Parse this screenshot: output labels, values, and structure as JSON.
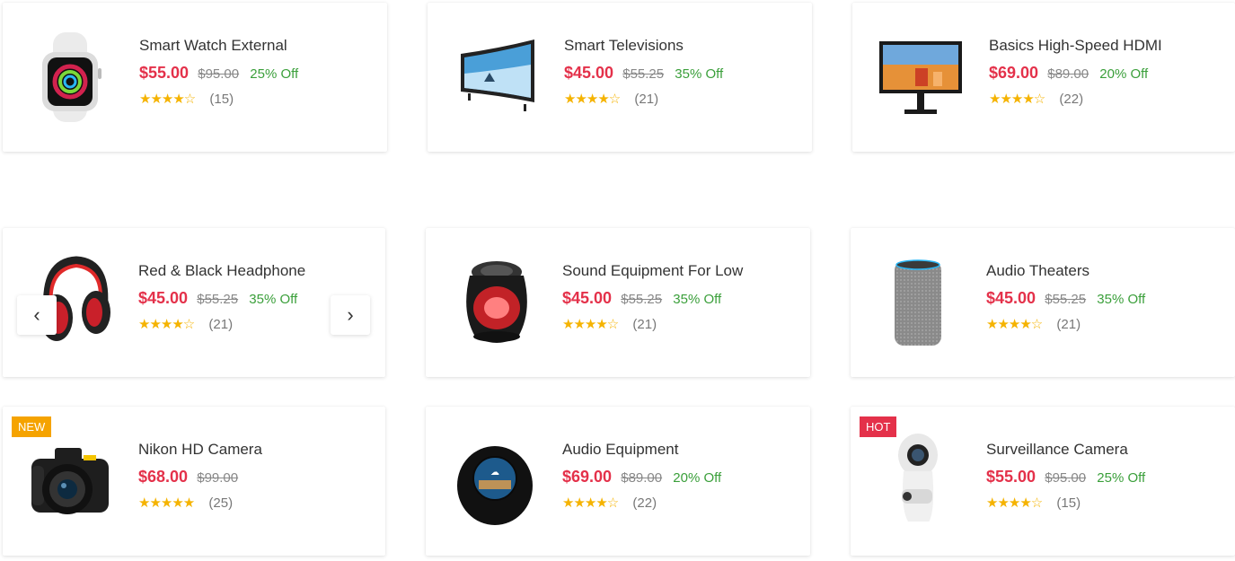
{
  "products": [
    {
      "title": "Smart Watch External",
      "price": "$55.00",
      "old_price": "$95.00",
      "discount": "25% Off",
      "stars": "★★★★☆",
      "review_count": "(15)",
      "image_icon": "smartwatch-icon"
    },
    {
      "title": "Smart Televisions",
      "price": "$45.00",
      "old_price": "$55.25",
      "discount": "35% Off",
      "stars": "★★★★☆",
      "review_count": "(21)",
      "image_icon": "curved-tv-icon"
    },
    {
      "title": "Basics High-Speed HDMI",
      "price": "$69.00",
      "old_price": "$89.00",
      "discount": "20% Off",
      "stars": "★★★★☆",
      "review_count": "(22)",
      "image_icon": "monitor-icon"
    },
    {
      "title": "Red & Black Headphone",
      "price": "$45.00",
      "old_price": "$55.25",
      "discount": "35% Off",
      "stars": "★★★★☆",
      "review_count": "(21)",
      "image_icon": "headphone-icon"
    },
    {
      "title": "Sound Equipment For Low",
      "price": "$45.00",
      "old_price": "$55.25",
      "discount": "35% Off",
      "stars": "★★★★☆",
      "review_count": "(21)",
      "image_icon": "speaker-icon"
    },
    {
      "title": "Audio Theaters",
      "price": "$45.00",
      "old_price": "$55.25",
      "discount": "35% Off",
      "stars": "★★★★☆",
      "review_count": "(21)",
      "image_icon": "smart-speaker-icon"
    },
    {
      "title": "Nikon HD Camera",
      "price": "$68.00",
      "old_price": "$99.00",
      "discount": "",
      "stars": "★★★★★",
      "review_count": "(25)",
      "badge": "NEW",
      "image_icon": "dslr-camera-icon"
    },
    {
      "title": "Audio Equipment",
      "price": "$69.00",
      "old_price": "$89.00",
      "discount": "20% Off",
      "stars": "★★★★☆",
      "review_count": "(22)",
      "image_icon": "echo-spot-icon"
    },
    {
      "title": "Surveillance Camera",
      "price": "$55.00",
      "old_price": "$95.00",
      "discount": "25% Off",
      "stars": "★★★★☆",
      "review_count": "(15)",
      "badge": "HOT",
      "image_icon": "360-camera-icon"
    }
  ],
  "carousel": {
    "prev_icon": "chevron-left-icon",
    "next_icon": "chevron-right-icon",
    "prev_glyph": "‹",
    "next_glyph": "›"
  },
  "colors": {
    "price": "#e4314a",
    "discount": "#3a9f3a",
    "stars": "#f5b300",
    "badge_new": "#f5a300",
    "badge_hot": "#e4314a"
  }
}
